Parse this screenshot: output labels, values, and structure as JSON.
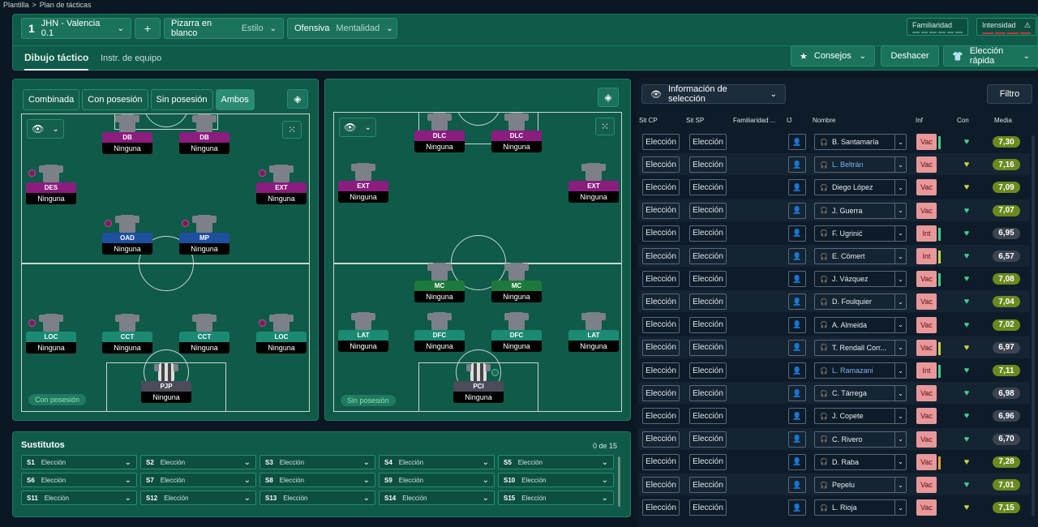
{
  "breadcrumb": {
    "parent": "Plantilla",
    "sep": ">",
    "current": "Plan de tácticas"
  },
  "topbar": {
    "tactic_number": "1",
    "tactic_name": "JHN - Valencia 0.1",
    "add_label": "+",
    "style_value": "Pizarra en blanco",
    "style_label": "Estilo",
    "mentality_value": "Ofensiva",
    "mentality_label": "Mentalidad",
    "familiarity_label": "Familiaridad",
    "intensity_label": "Intensidad",
    "tabs": [
      "Dibujo táctico",
      "Instr. de equipo"
    ],
    "advice_label": "Consejos",
    "undo_label": "Deshacer",
    "quick_pick_label": "Elección rápida"
  },
  "left": {
    "modes": [
      "Combinada",
      "Con posesión",
      "Sin posesión",
      "Ambos"
    ],
    "phase_chip": "Con posesión",
    "players": [
      {
        "role": "DB",
        "duty": "Ninguna"
      },
      {
        "role": "DB",
        "duty": "Ninguna"
      },
      {
        "role": "DES",
        "duty": "Ninguna"
      },
      {
        "role": "EXT",
        "duty": "Ninguna"
      },
      {
        "role": "OAD",
        "duty": "Ninguna"
      },
      {
        "role": "MP",
        "duty": "Ninguna"
      },
      {
        "role": "LOC",
        "duty": "Ninguna"
      },
      {
        "role": "CCT",
        "duty": "Ninguna"
      },
      {
        "role": "CCT",
        "duty": "Ninguna"
      },
      {
        "role": "LOC",
        "duty": "Ninguna"
      },
      {
        "role": "PJP",
        "duty": "Ninguna"
      }
    ]
  },
  "mid": {
    "phase_chip": "Sin posesión",
    "players": [
      {
        "role": "DLC",
        "duty": "Ninguna"
      },
      {
        "role": "DLC",
        "duty": "Ninguna"
      },
      {
        "role": "EXT",
        "duty": "Ninguna"
      },
      {
        "role": "EXT",
        "duty": "Ninguna"
      },
      {
        "role": "MC",
        "duty": "Ninguna"
      },
      {
        "role": "MC",
        "duty": "Ninguna"
      },
      {
        "role": "LAT",
        "duty": "Ninguna"
      },
      {
        "role": "DFC",
        "duty": "Ninguna"
      },
      {
        "role": "DFC",
        "duty": "Ninguna"
      },
      {
        "role": "LAT",
        "duty": "Ninguna"
      },
      {
        "role": "PCI",
        "duty": "Ninguna"
      }
    ]
  },
  "subs": {
    "title": "Sustitutos",
    "count": "0 de 15",
    "slots": [
      {
        "id": "S1",
        "value": "Elección"
      },
      {
        "id": "S2",
        "value": "Elección"
      },
      {
        "id": "S3",
        "value": "Elección"
      },
      {
        "id": "S4",
        "value": "Elección"
      },
      {
        "id": "S5",
        "value": "Elección"
      },
      {
        "id": "S6",
        "value": "Elección"
      },
      {
        "id": "S7",
        "value": "Elección"
      },
      {
        "id": "S8",
        "value": "Elección"
      },
      {
        "id": "S9",
        "value": "Elección"
      },
      {
        "id": "S10",
        "value": "Elección"
      },
      {
        "id": "S11",
        "value": "Elección"
      },
      {
        "id": "S12",
        "value": "Elección"
      },
      {
        "id": "S13",
        "value": "Elección"
      },
      {
        "id": "S14",
        "value": "Elección"
      },
      {
        "id": "S15",
        "value": "Elección"
      }
    ]
  },
  "right": {
    "info_label": "Información de selección",
    "filter_label": "Filtro",
    "headers": [
      "Sit CP",
      "Sit SP",
      "Familiaridad ...",
      "IJ",
      "Nombre",
      "Inf",
      "Con",
      "Media"
    ],
    "rows": [
      {
        "cp": "Elección",
        "sp": "Elección",
        "name": "B. Santamaría",
        "linked": false,
        "inf": "Vac",
        "bar": "#3fd08a",
        "heart": "#3fd08a",
        "media": "7,30",
        "mcolor": "#6b8a1e"
      },
      {
        "cp": "Elección",
        "sp": "Elección",
        "name": "L. Beltrán",
        "linked": true,
        "inf": "Vac",
        "bar": "",
        "heart": "#c9d43a",
        "media": "7,16",
        "mcolor": "#6b8a1e"
      },
      {
        "cp": "Elección",
        "sp": "Elección",
        "name": "Diego López",
        "linked": false,
        "inf": "Vac",
        "bar": "",
        "heart": "#c9d43a",
        "media": "7,09",
        "mcolor": "#6b8a1e"
      },
      {
        "cp": "Elección",
        "sp": "Elección",
        "name": "J. Guerra",
        "linked": false,
        "inf": "Vac",
        "bar": "",
        "heart": "#3fd08a",
        "media": "7,07",
        "mcolor": "#6b8a1e"
      },
      {
        "cp": "Elección",
        "sp": "Elección",
        "name": "F. Ugrinić",
        "linked": false,
        "inf": "Int",
        "bar": "#3fd08a",
        "heart": "#3fd08a",
        "media": "6,95",
        "mcolor": "#3b4450"
      },
      {
        "cp": "Elección",
        "sp": "Elección",
        "name": "E. Cömert",
        "linked": false,
        "inf": "Int",
        "bar": "#c9d43a",
        "heart": "#3fd08a",
        "media": "6,57",
        "mcolor": "#3b4450"
      },
      {
        "cp": "Elección",
        "sp": "Elección",
        "name": "J. Vázquez",
        "linked": false,
        "inf": "Vac",
        "bar": "#3fd08a",
        "heart": "#3fd08a",
        "media": "7,08",
        "mcolor": "#6b8a1e"
      },
      {
        "cp": "Elección",
        "sp": "Elección",
        "name": "D. Foulquier",
        "linked": false,
        "inf": "Vac",
        "bar": "",
        "heart": "#3fd08a",
        "media": "7,04",
        "mcolor": "#6b8a1e"
      },
      {
        "cp": "Elección",
        "sp": "Elección",
        "name": "A. Almeida",
        "linked": false,
        "inf": "Vac",
        "bar": "",
        "heart": "#3fd08a",
        "media": "7,02",
        "mcolor": "#6b8a1e"
      },
      {
        "cp": "Elección",
        "sp": "Elección",
        "name": "T. Rendall Corr...",
        "linked": false,
        "inf": "Vac",
        "bar": "#c9d43a",
        "heart": "#c9d43a",
        "media": "6,97",
        "mcolor": "#3b4450"
      },
      {
        "cp": "Elección",
        "sp": "Elección",
        "name": "L. Ramazani",
        "linked": true,
        "inf": "Int",
        "bar": "#3fd08a",
        "heart": "#3fd08a",
        "media": "7,11",
        "mcolor": "#6b8a1e"
      },
      {
        "cp": "Elección",
        "sp": "Elección",
        "name": "C. Tárrega",
        "linked": false,
        "inf": "Vac",
        "bar": "",
        "heart": "#3fd08a",
        "media": "6,98",
        "mcolor": "#3b4450"
      },
      {
        "cp": "Elección",
        "sp": "Elección",
        "name": "J. Copete",
        "linked": false,
        "inf": "Vac",
        "bar": "",
        "heart": "#3fd08a",
        "media": "6,96",
        "mcolor": "#3b4450"
      },
      {
        "cp": "Elección",
        "sp": "Elección",
        "name": "C. Rivero",
        "linked": false,
        "inf": "Vac",
        "bar": "",
        "heart": "#3fd08a",
        "media": "6,70",
        "mcolor": "#3b4450"
      },
      {
        "cp": "Elección",
        "sp": "Elección",
        "name": "D. Raba",
        "linked": false,
        "inf": "Vac",
        "bar": "#e0a030",
        "heart": "#c9d43a",
        "media": "7,28",
        "mcolor": "#6b8a1e"
      },
      {
        "cp": "Elección",
        "sp": "Elección",
        "name": "Pepelu",
        "linked": false,
        "inf": "Vac",
        "bar": "",
        "heart": "#3fd08a",
        "media": "7,01",
        "mcolor": "#6b8a1e"
      },
      {
        "cp": "Elección",
        "sp": "Elección",
        "name": "L. Rioja",
        "linked": false,
        "inf": "Vac",
        "bar": "",
        "heart": "#c9d43a",
        "media": "7,15",
        "mcolor": "#6b8a1e"
      }
    ]
  }
}
